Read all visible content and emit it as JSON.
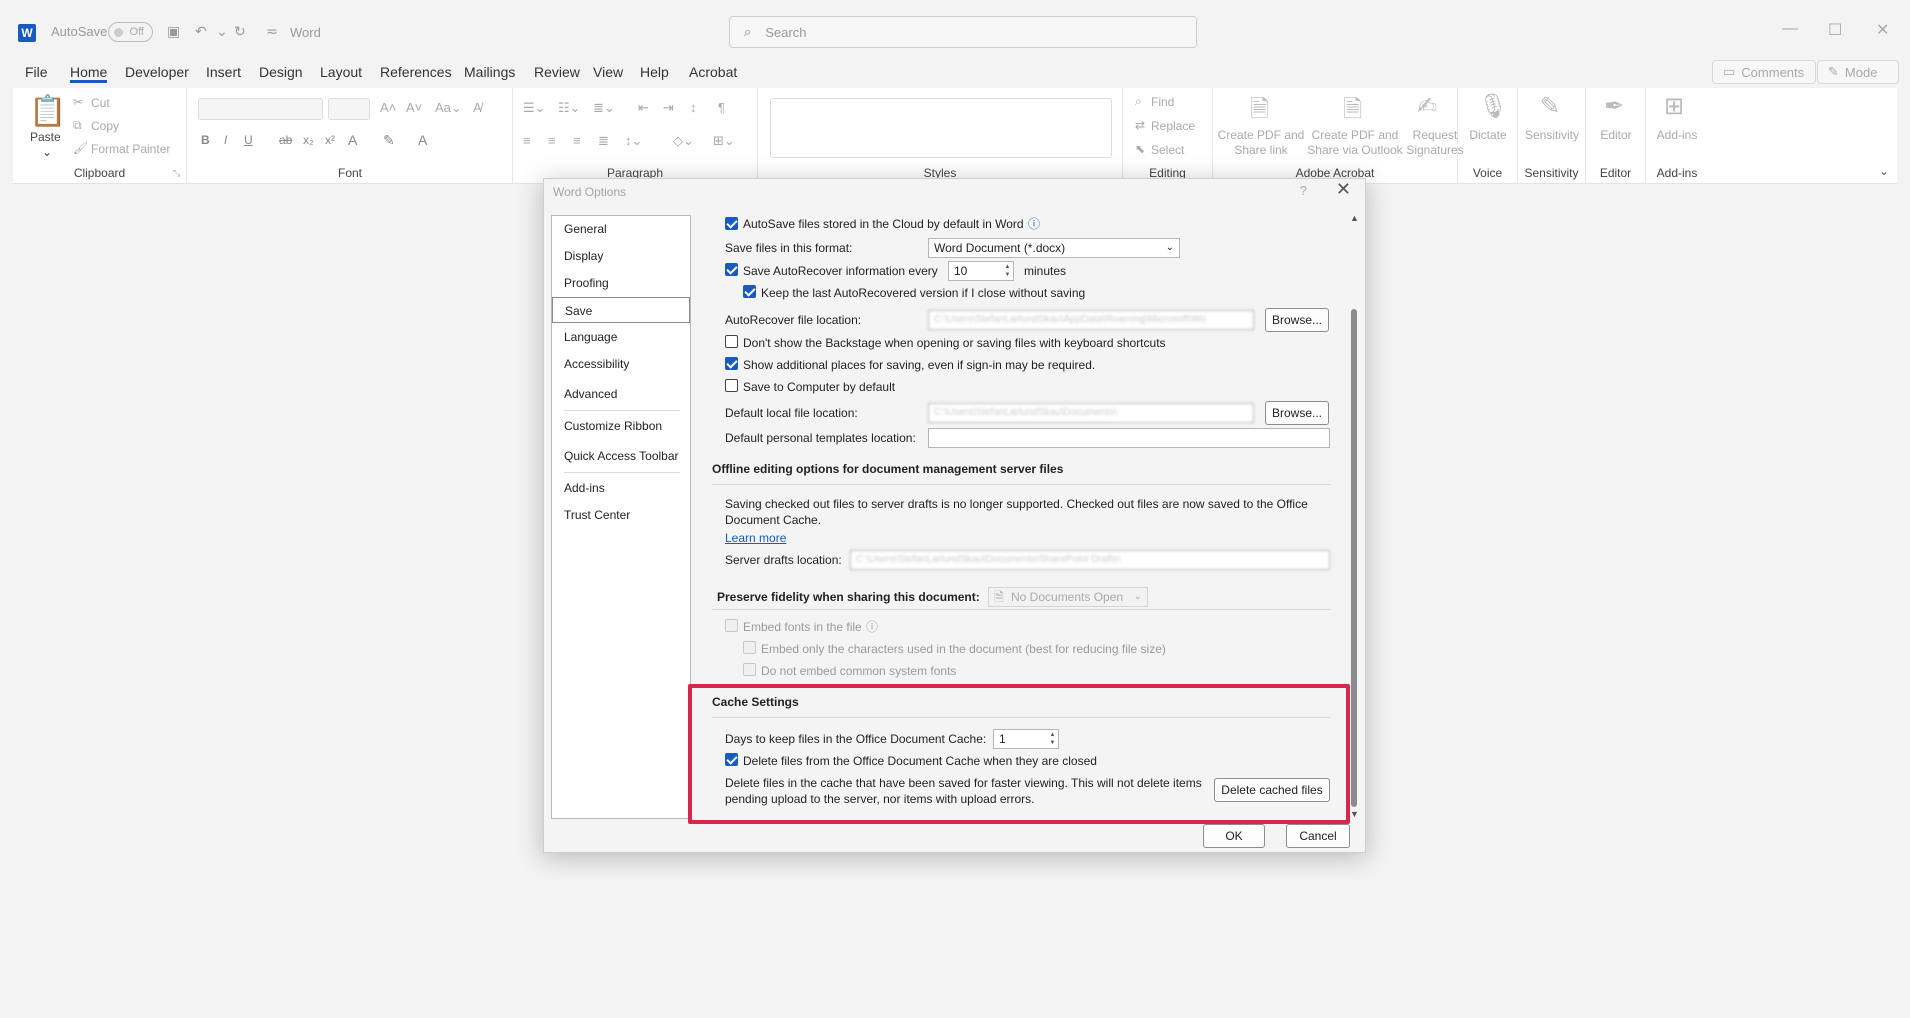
{
  "titlebar": {
    "autosave_label": "AutoSave",
    "autosave_state": "Off",
    "app_title": "Word",
    "search_placeholder": "Search"
  },
  "menu": {
    "tabs": [
      "File",
      "Home",
      "Developer",
      "Insert",
      "Design",
      "Layout",
      "References",
      "Mailings",
      "Review",
      "View",
      "Help",
      "Acrobat"
    ],
    "active": "Home",
    "comments": "Comments",
    "mode": "Mode"
  },
  "ribbon": {
    "clipboard": {
      "label": "Clipboard",
      "paste": "Paste",
      "cut": "Cut",
      "copy": "Copy",
      "format_painter": "Format Painter"
    },
    "font": {
      "label": "Font"
    },
    "paragraph": {
      "label": "Paragraph"
    },
    "styles": {
      "label": "Styles"
    },
    "editing": {
      "label": "Editing",
      "find": "Find",
      "replace": "Replace",
      "select": "Select"
    },
    "acrobat": {
      "label": "Adobe Acrobat",
      "create_pdf_share": "Create PDF and Share link",
      "create_pdf_outlook": "Create PDF and Share via Outlook",
      "request_signatures": "Request Signatures"
    },
    "voice": {
      "label": "Voice",
      "dictate": "Dictate"
    },
    "sensitivity": {
      "label": "Sensitivity",
      "button": "Sensitivity"
    },
    "editor": {
      "label": "Editor",
      "button": "Editor"
    },
    "addins": {
      "label": "Add-ins",
      "button": "Add-ins"
    }
  },
  "dialog": {
    "title": "Word Options",
    "help": "?",
    "nav": [
      "General",
      "Display",
      "Proofing",
      "Save",
      "Language",
      "Accessibility",
      "Advanced",
      "Customize Ribbon",
      "Quick Access Toolbar",
      "Add-ins",
      "Trust Center"
    ],
    "selected_nav": "Save",
    "save": {
      "autosave_cloud": "AutoSave files stored in the Cloud by default in Word",
      "save_format_label": "Save files in this format:",
      "save_format_value": "Word Document (*.docx)",
      "autorecover_label": "Save AutoRecover information every",
      "autorecover_minutes": "10",
      "minutes_label": "minutes",
      "keep_last": "Keep the last AutoRecovered version if I close without saving",
      "autorecover_location_label": "AutoRecover file location:",
      "autorecover_location_value": "C:\\Users\\StefanLarlundSkau\\AppData\\Roaming\\Microsoft\\Wo",
      "browse": "Browse...",
      "dont_show_backstage": "Don't show the Backstage when opening or saving files with keyboard shortcuts",
      "show_additional": "Show additional places for saving, even if sign-in may be required.",
      "save_to_computer": "Save to Computer by default",
      "default_local_label": "Default local file location:",
      "default_local_value": "C:\\Users\\StefanLarlundSkau\\Documents\\",
      "default_templates_label": "Default personal templates location:",
      "default_templates_value": ""
    },
    "offline": {
      "heading": "Offline editing options for document management server files",
      "note": "Saving checked out files to server drafts is no longer supported. Checked out files are now saved to the Office",
      "note2": "Document Cache.",
      "learn_more": "Learn more",
      "drafts_label": "Server drafts location:",
      "drafts_value": "C:\\Users\\StefanLarlundSkau\\Documents\\SharePoint Drafts\\"
    },
    "fidelity": {
      "heading": "Preserve fidelity when sharing this document:",
      "doc_value": "No Documents Open",
      "embed_fonts": "Embed fonts in the file",
      "embed_only": "Embed only the characters used in the document (best for reducing file size)",
      "no_common": "Do not embed common system fonts"
    },
    "cache": {
      "heading": "Cache Settings",
      "days_label": "Days to keep files in the Office Document Cache:",
      "days_value": "1",
      "delete_closed": "Delete files from the Office Document Cache when they are closed",
      "delete_note": "Delete files in the cache that have been saved for faster viewing. This will not delete items",
      "delete_note2": "pending upload to the server, nor items with upload errors.",
      "delete_button": "Delete cached files"
    },
    "ok": "OK",
    "cancel": "Cancel"
  },
  "colors": {
    "accent": "#185abd",
    "highlight": "#d6284f"
  }
}
